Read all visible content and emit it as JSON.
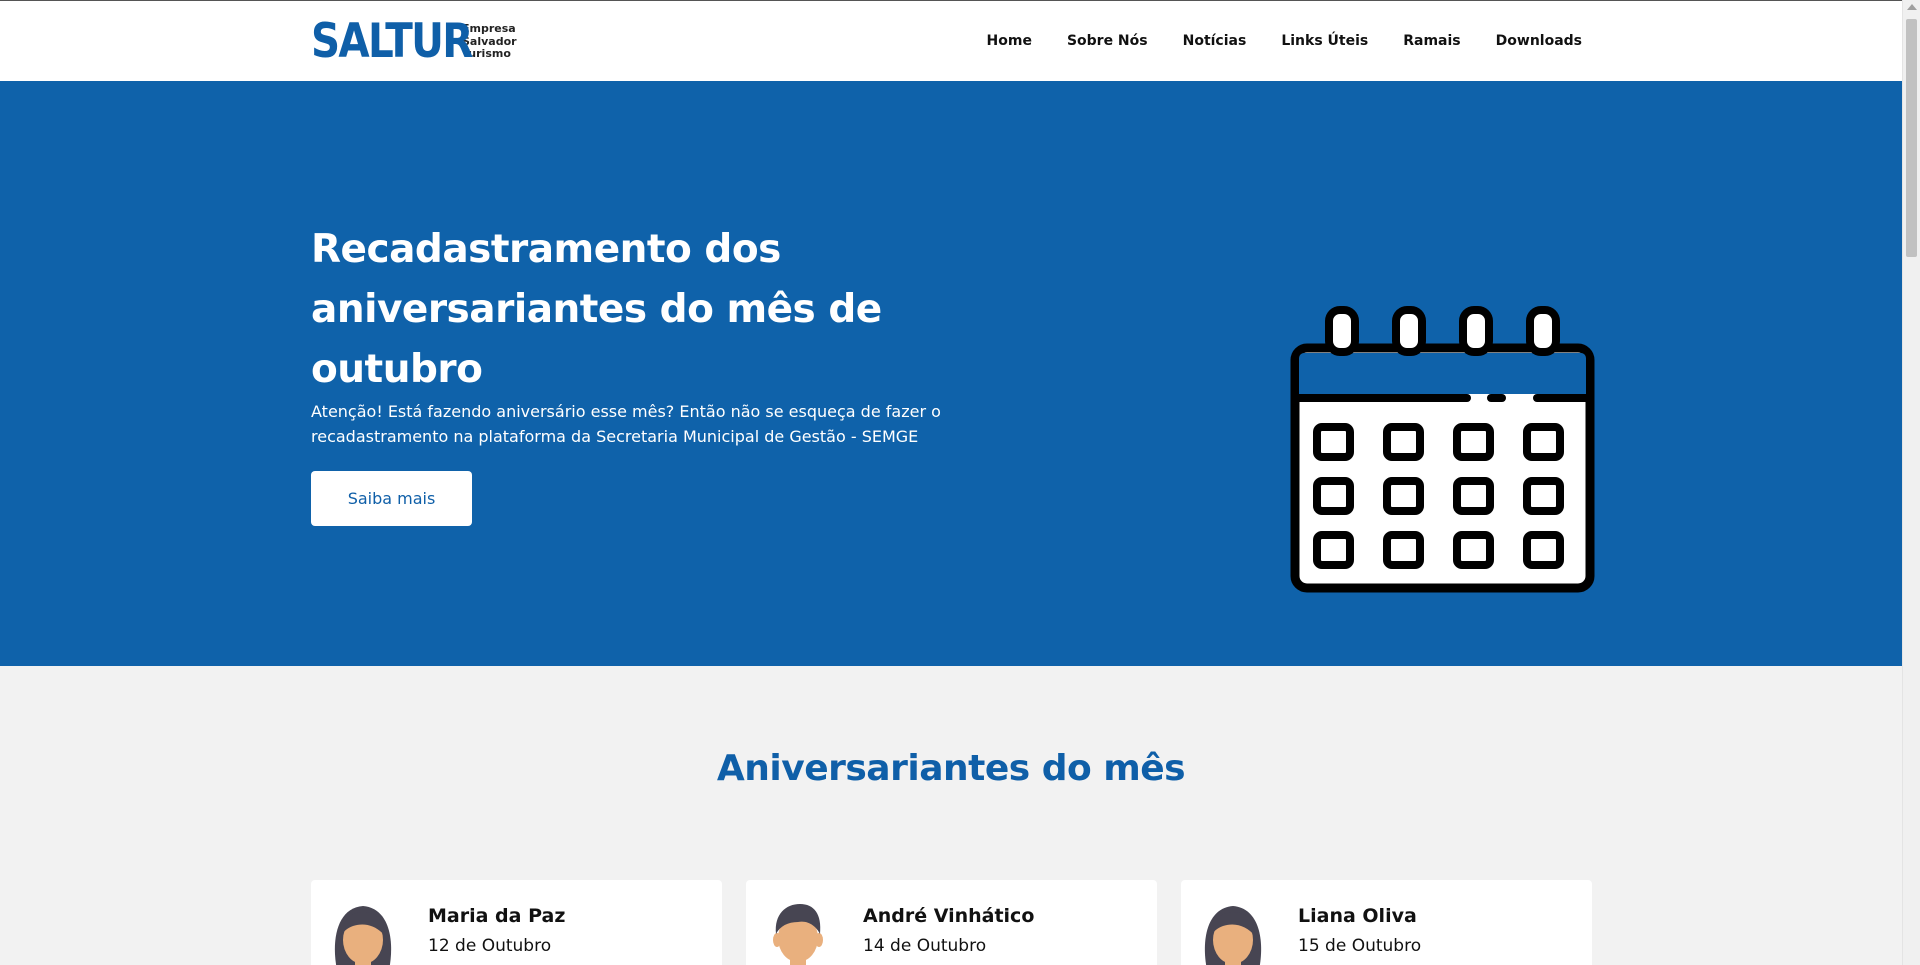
{
  "header": {
    "logo_word": "SALTUR",
    "logo_sub": [
      "Empresa",
      "Salvador",
      "Turismo"
    ],
    "nav": [
      "Home",
      "Sobre Nós",
      "Notícias",
      "Links Úteis",
      "Ramais",
      "Downloads"
    ]
  },
  "hero": {
    "title": "Recadastramento dos aniversariantes do mês de outubro",
    "text": "Atenção! Está fazendo aniversário esse mês? Então não se esqueça de fazer o recadastramento na plataforma da Secretaria Municipal de Gestão - SEMGE",
    "button": "Saiba mais",
    "icon": "calendar-icon"
  },
  "birthdays": {
    "title": "Aniversariantes do mês",
    "cards": [
      {
        "name": "Maria da Paz",
        "date": "12 de Outubro",
        "avatar": "female-avatar-icon"
      },
      {
        "name": "André Vinhático",
        "date": "14 de Outubro",
        "avatar": "male-avatar-icon"
      },
      {
        "name": "Liana Oliva",
        "date": "15 de Outubro",
        "avatar": "female-avatar-icon"
      }
    ]
  },
  "colors": {
    "brand_blue": "#0f62aa",
    "white": "#ffffff",
    "background": "#f2f2f2",
    "skin": "#e9b07e",
    "hair": "#474552"
  }
}
